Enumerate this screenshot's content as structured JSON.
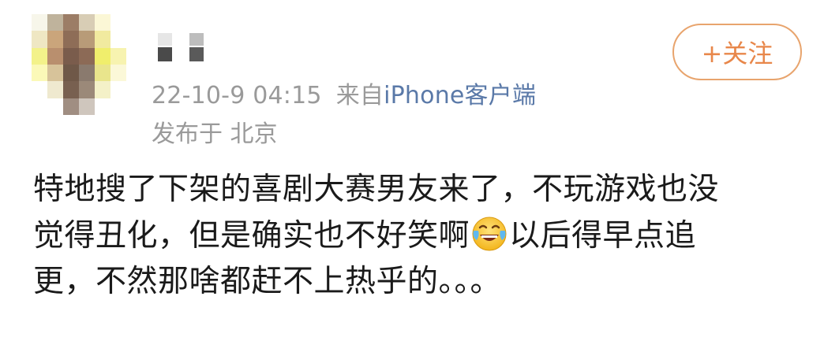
{
  "post": {
    "avatar": {
      "pixels": [
        [
          "#f7f6ea",
          "#bfb39c",
          "#9c7d66",
          "#d8cdb5",
          "#fbf7d6",
          "#ffffff"
        ],
        [
          "#efe7c3",
          "#caa57b",
          "#8e6d57",
          "#b89b78",
          "#f1ea9f",
          "#ffffff"
        ],
        [
          "#f3f28a",
          "#b98f6e",
          "#7a5c4c",
          "#8c6a56",
          "#f0ee6c",
          "#f7f3b0"
        ],
        [
          "#fbf9b8",
          "#d7c39a",
          "#6f5848",
          "#8a7a6e",
          "#e9e58c",
          "#fbf8d8"
        ],
        [
          "#ffffff",
          "#efe9cf",
          "#786050",
          "#9b8979",
          "#f4f1c8",
          "#ffffff"
        ],
        [
          "#ffffff",
          "#ffffff",
          "#a08e82",
          "#cfc6bd",
          "#ffffff",
          "#ffffff"
        ]
      ]
    },
    "meta": {
      "time": "22-10-9 04:15",
      "from_prefix": "来自",
      "device": "iPhone客户端"
    },
    "location": "发布于 北京",
    "follow_label": "+关注",
    "content": {
      "line1": "特地搜了下架的喜剧大赛男友来了，不玩游戏也没",
      "line2_before": "觉得丑化，但是确实也不好笑啊",
      "emoji": "laughing-crying",
      "line2_after": "以后得早点追",
      "line3": "更，不然那啥都赶不上热乎的。。。"
    }
  }
}
